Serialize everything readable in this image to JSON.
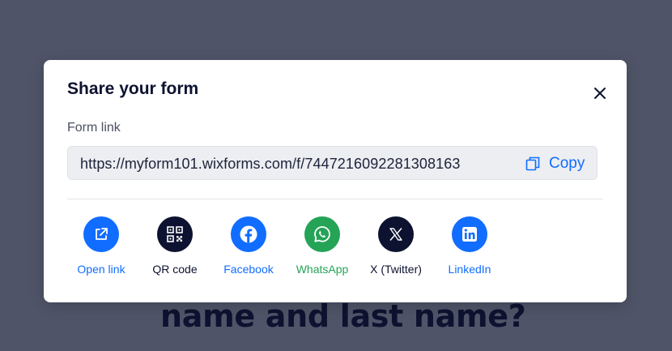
{
  "background": {
    "text": "name and last name?"
  },
  "modal": {
    "title": "Share your form",
    "field_label": "Form link",
    "link_url": "https://myform101.wixforms.com/f/7447216092281308163",
    "copy_label": "Copy"
  },
  "share_options": [
    {
      "label": "Open link",
      "icon": "open-link-icon",
      "circle_color": "#116dff",
      "label_color": "#116dff"
    },
    {
      "label": "QR code",
      "icon": "qr-code-icon",
      "circle_color": "#0d1230",
      "label_color": "#0d1230"
    },
    {
      "label": "Facebook",
      "icon": "facebook-icon",
      "circle_color": "#116dff",
      "label_color": "#116dff"
    },
    {
      "label": "WhatsApp",
      "icon": "whatsapp-icon",
      "circle_color": "#25a357",
      "label_color": "#25a357"
    },
    {
      "label": "X (Twitter)",
      "icon": "x-twitter-icon",
      "circle_color": "#0d1230",
      "label_color": "#0d1230"
    },
    {
      "label": "LinkedIn",
      "icon": "linkedin-icon",
      "circle_color": "#116dff",
      "label_color": "#116dff"
    }
  ],
  "colors": {
    "accent": "#116dff",
    "dark": "#0d1230",
    "whatsapp": "#25a357",
    "overlay": "#4f5468"
  }
}
